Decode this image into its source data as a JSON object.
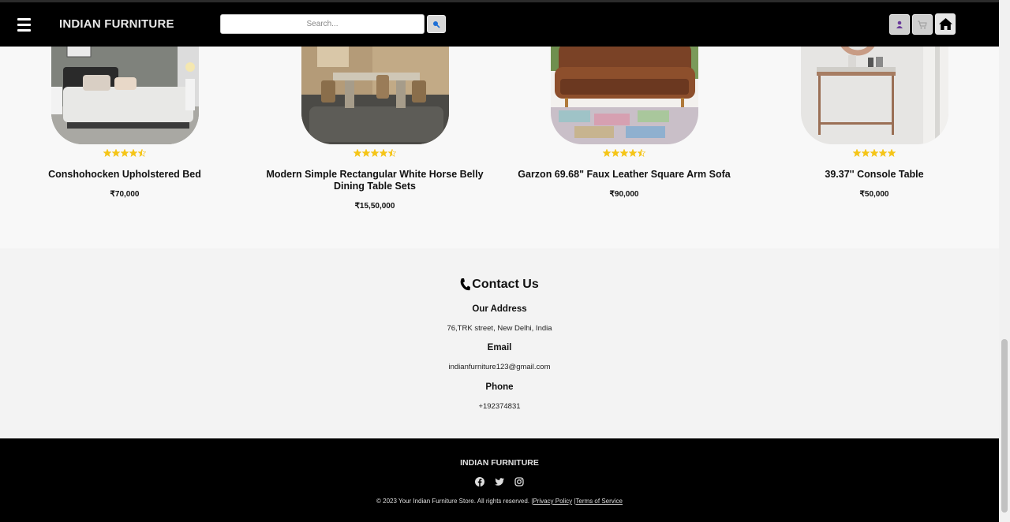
{
  "header": {
    "brand": "INDIAN FURNITURE",
    "search_placeholder": "Search...",
    "menu_icon": "hamburger-icon",
    "search_icon": "search-icon",
    "user_icon": "user-icon",
    "cart_icon": "cart-icon",
    "home_icon": "home-icon"
  },
  "products": [
    {
      "name": "Conshohocken Upholstered Bed",
      "price": "₹70,000",
      "rating": 4.5
    },
    {
      "name": "Modern Simple Rectangular White Horse Belly Dining Table Sets",
      "price": "₹15,50,000",
      "rating": 4.5
    },
    {
      "name": "Garzon 69.68\" Faux Leather Square Arm Sofa",
      "price": "₹90,000",
      "rating": 4.5
    },
    {
      "name": "39.37'' Console Table",
      "price": "₹50,000",
      "rating": 5
    }
  ],
  "contact": {
    "title": "Contact Us",
    "address_label": "Our Address",
    "address": "76,TRK street, New Delhi, India",
    "email_label": "Email",
    "email": "indianfurniture123@gmail.com",
    "phone_label": "Phone",
    "phone": "+192374831"
  },
  "footer": {
    "brand": "INDIAN FURNITURE",
    "social": [
      "facebook-icon",
      "twitter-icon",
      "instagram-icon"
    ],
    "copyright": "© 2023 Your Indian Furniture Store. All rights reserved. |",
    "privacy": "Privacy Policy",
    "separator": " |",
    "terms": "Terms of Service"
  },
  "colors": {
    "header_bg": "#000000",
    "star": "#f5c518",
    "footer_bg": "#000000",
    "contact_bg": "#f3f3f3"
  }
}
